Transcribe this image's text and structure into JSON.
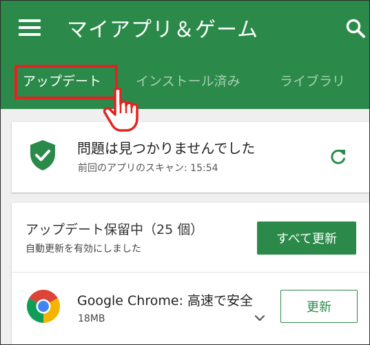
{
  "app_bar": {
    "title": "マイアプリ＆ゲーム",
    "menu_icon": "hamburger-menu-icon",
    "search_icon": "search-icon",
    "color": "#2b8a4a"
  },
  "tabs": [
    {
      "label": "アップデート",
      "selected": true
    },
    {
      "label": "インストール済み",
      "selected": false
    },
    {
      "label": "ライブラリ",
      "selected": false
    }
  ],
  "highlight_color": "#e52121",
  "status_card": {
    "icon": "shield-check-icon",
    "title": "問題は見つかりませんでした",
    "subtitle": "前回のアプリのスキャン: 15:54",
    "refresh_icon": "refresh-icon"
  },
  "pending": {
    "title": "アップデート保留中（25 個）",
    "subtitle": "自動更新を有効にしました",
    "update_all_label": "すべて更新"
  },
  "apps": [
    {
      "name": "Google Chrome: 高速で安全",
      "size": "18MB",
      "update_label": "更新",
      "icon": "chrome-icon"
    }
  ],
  "pointer_icon": "hand-pointer-icon"
}
